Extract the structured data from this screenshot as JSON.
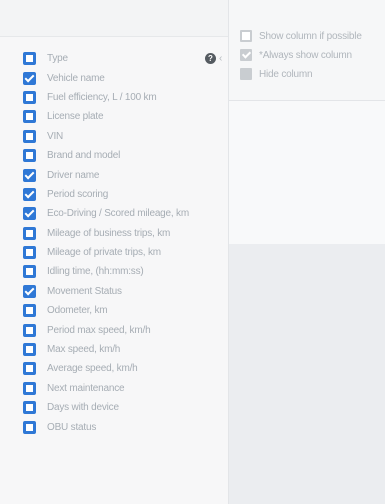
{
  "columns_panel": {
    "items": [
      {
        "label": "Type",
        "checked": false
      },
      {
        "label": "Vehicle name",
        "checked": true
      },
      {
        "label": "Fuel efficiency, L / 100 km",
        "checked": false
      },
      {
        "label": "License plate",
        "checked": false
      },
      {
        "label": "VIN",
        "checked": false
      },
      {
        "label": "Brand and model",
        "checked": false
      },
      {
        "label": "Driver name",
        "checked": true
      },
      {
        "label": "Period scoring",
        "checked": true
      },
      {
        "label": "Eco-Driving / Scored mileage, km",
        "checked": true
      },
      {
        "label": "Mileage of business trips, km",
        "checked": false
      },
      {
        "label": "Mileage of private trips, km",
        "checked": false
      },
      {
        "label": "Idling time, (hh:mm:ss)",
        "checked": false
      },
      {
        "label": "Movement Status",
        "checked": true
      },
      {
        "label": "Odometer, km",
        "checked": false
      },
      {
        "label": "Period max speed, km/h",
        "checked": false
      },
      {
        "label": "Max speed, km/h",
        "checked": false
      },
      {
        "label": "Average speed, km/h",
        "checked": false
      },
      {
        "label": "Next maintenance",
        "checked": false
      },
      {
        "label": "Days with device",
        "checked": false
      },
      {
        "label": "OBU status",
        "checked": false
      }
    ],
    "help_icon": "?",
    "chevron_icon": "‹"
  },
  "legend": {
    "show_if_possible": "Show column if possible",
    "always_show": "*Always show column",
    "hide": "Hide column"
  },
  "colors": {
    "accent": "#2f78d6",
    "legend_gray": "#c9cdd1"
  }
}
